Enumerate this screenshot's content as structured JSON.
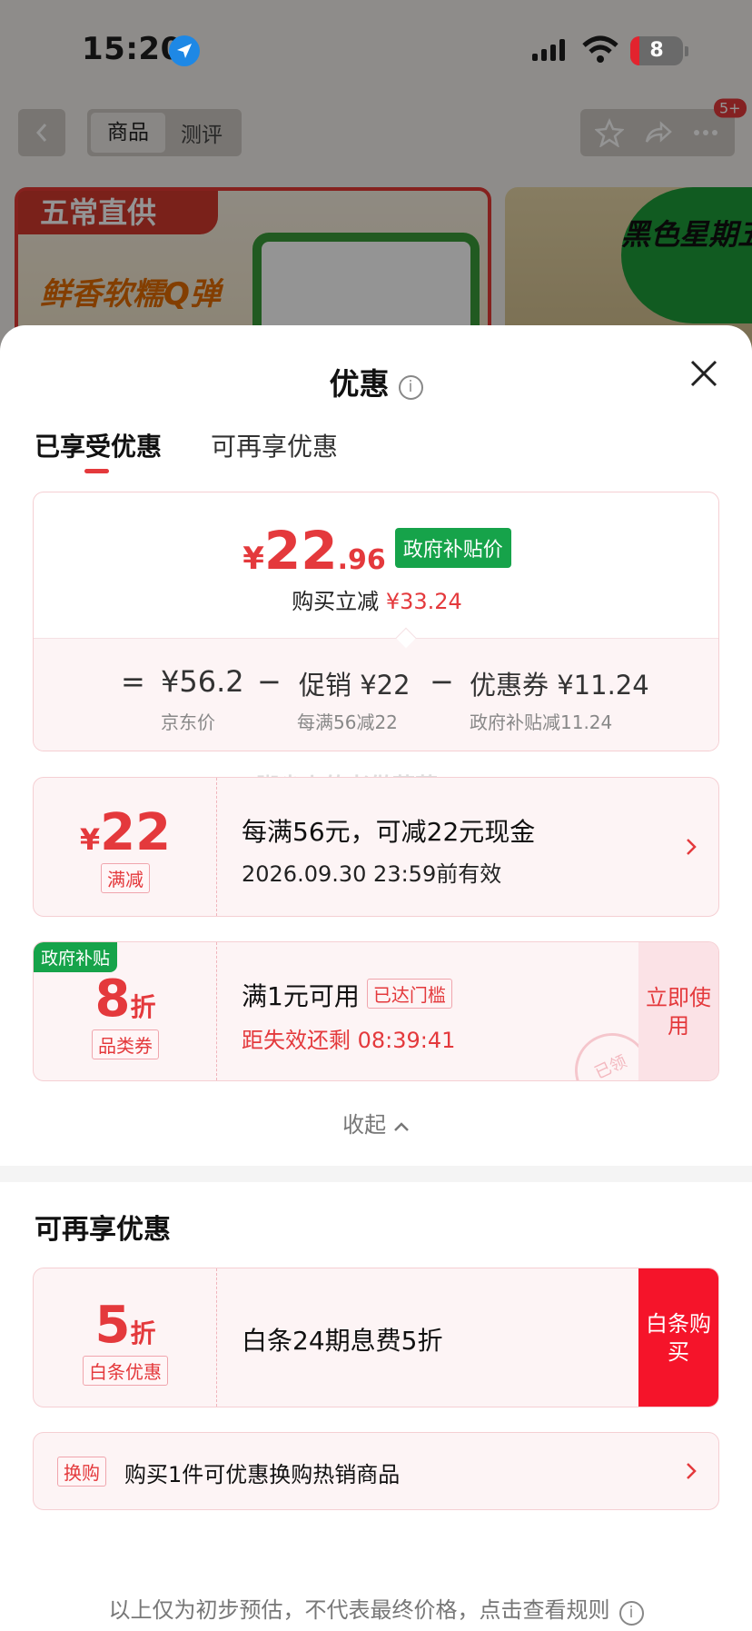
{
  "status_bar": {
    "time": "15:20",
    "battery": "8"
  },
  "product_header": {
    "tabs": [
      "商品",
      "测评"
    ],
    "badge": "5+",
    "banner_tag": "五常直供",
    "banner_slogan": "鲜香软糯Q弹",
    "promo_label": "黑色星期五"
  },
  "sheet": {
    "title": "优惠",
    "tabs": [
      "已享受优惠",
      "可再享优惠"
    ],
    "summary": {
      "yen": "¥",
      "price_int": "22",
      "price_dec": ".96",
      "price_tag": "政府补贴价",
      "reduce_label": "购买立减",
      "reduce_value": "¥33.24",
      "eq": "=",
      "minus": "−",
      "jd_price": "¥56.2",
      "jd_label": "京东价",
      "promo": "促销 ¥22",
      "promo_label": "每满56减22",
      "coupon": "优惠券 ¥11.24",
      "coupon_label": "政府补贴减11.24"
    },
    "watermark": "脚尖上的老傲藏菜",
    "coupons": [
      {
        "value_yen": "¥",
        "value": "22",
        "label": "满减",
        "title": "每满56元，可减22元现金",
        "subtitle": "2026.09.30 23:59前有效"
      },
      {
        "corner": "政府补贴",
        "value": "8",
        "value_unit": "折",
        "label": "品类券",
        "title": "满1元可用",
        "badge": "已达门槛",
        "subtitle": "距失效还剩 08:39:41",
        "button": "立即使用",
        "stamp": "已领"
      }
    ],
    "collapse_label": "收起",
    "more_title": "可再享优惠",
    "baitiao": {
      "value": "5",
      "value_unit": "折",
      "label": "白条优惠",
      "title": "白条24期息费5折",
      "button": "白条购买"
    },
    "exchange": {
      "tag": "换购",
      "text": "购买1件可优惠换购热销商品"
    },
    "footnote": "以上仅为初步预估，不代表最终价格，点击查看规则"
  },
  "colors": {
    "accent_red": "#e4393c",
    "gov_green": "#16a34a",
    "baitiao_red": "#f5142a"
  }
}
